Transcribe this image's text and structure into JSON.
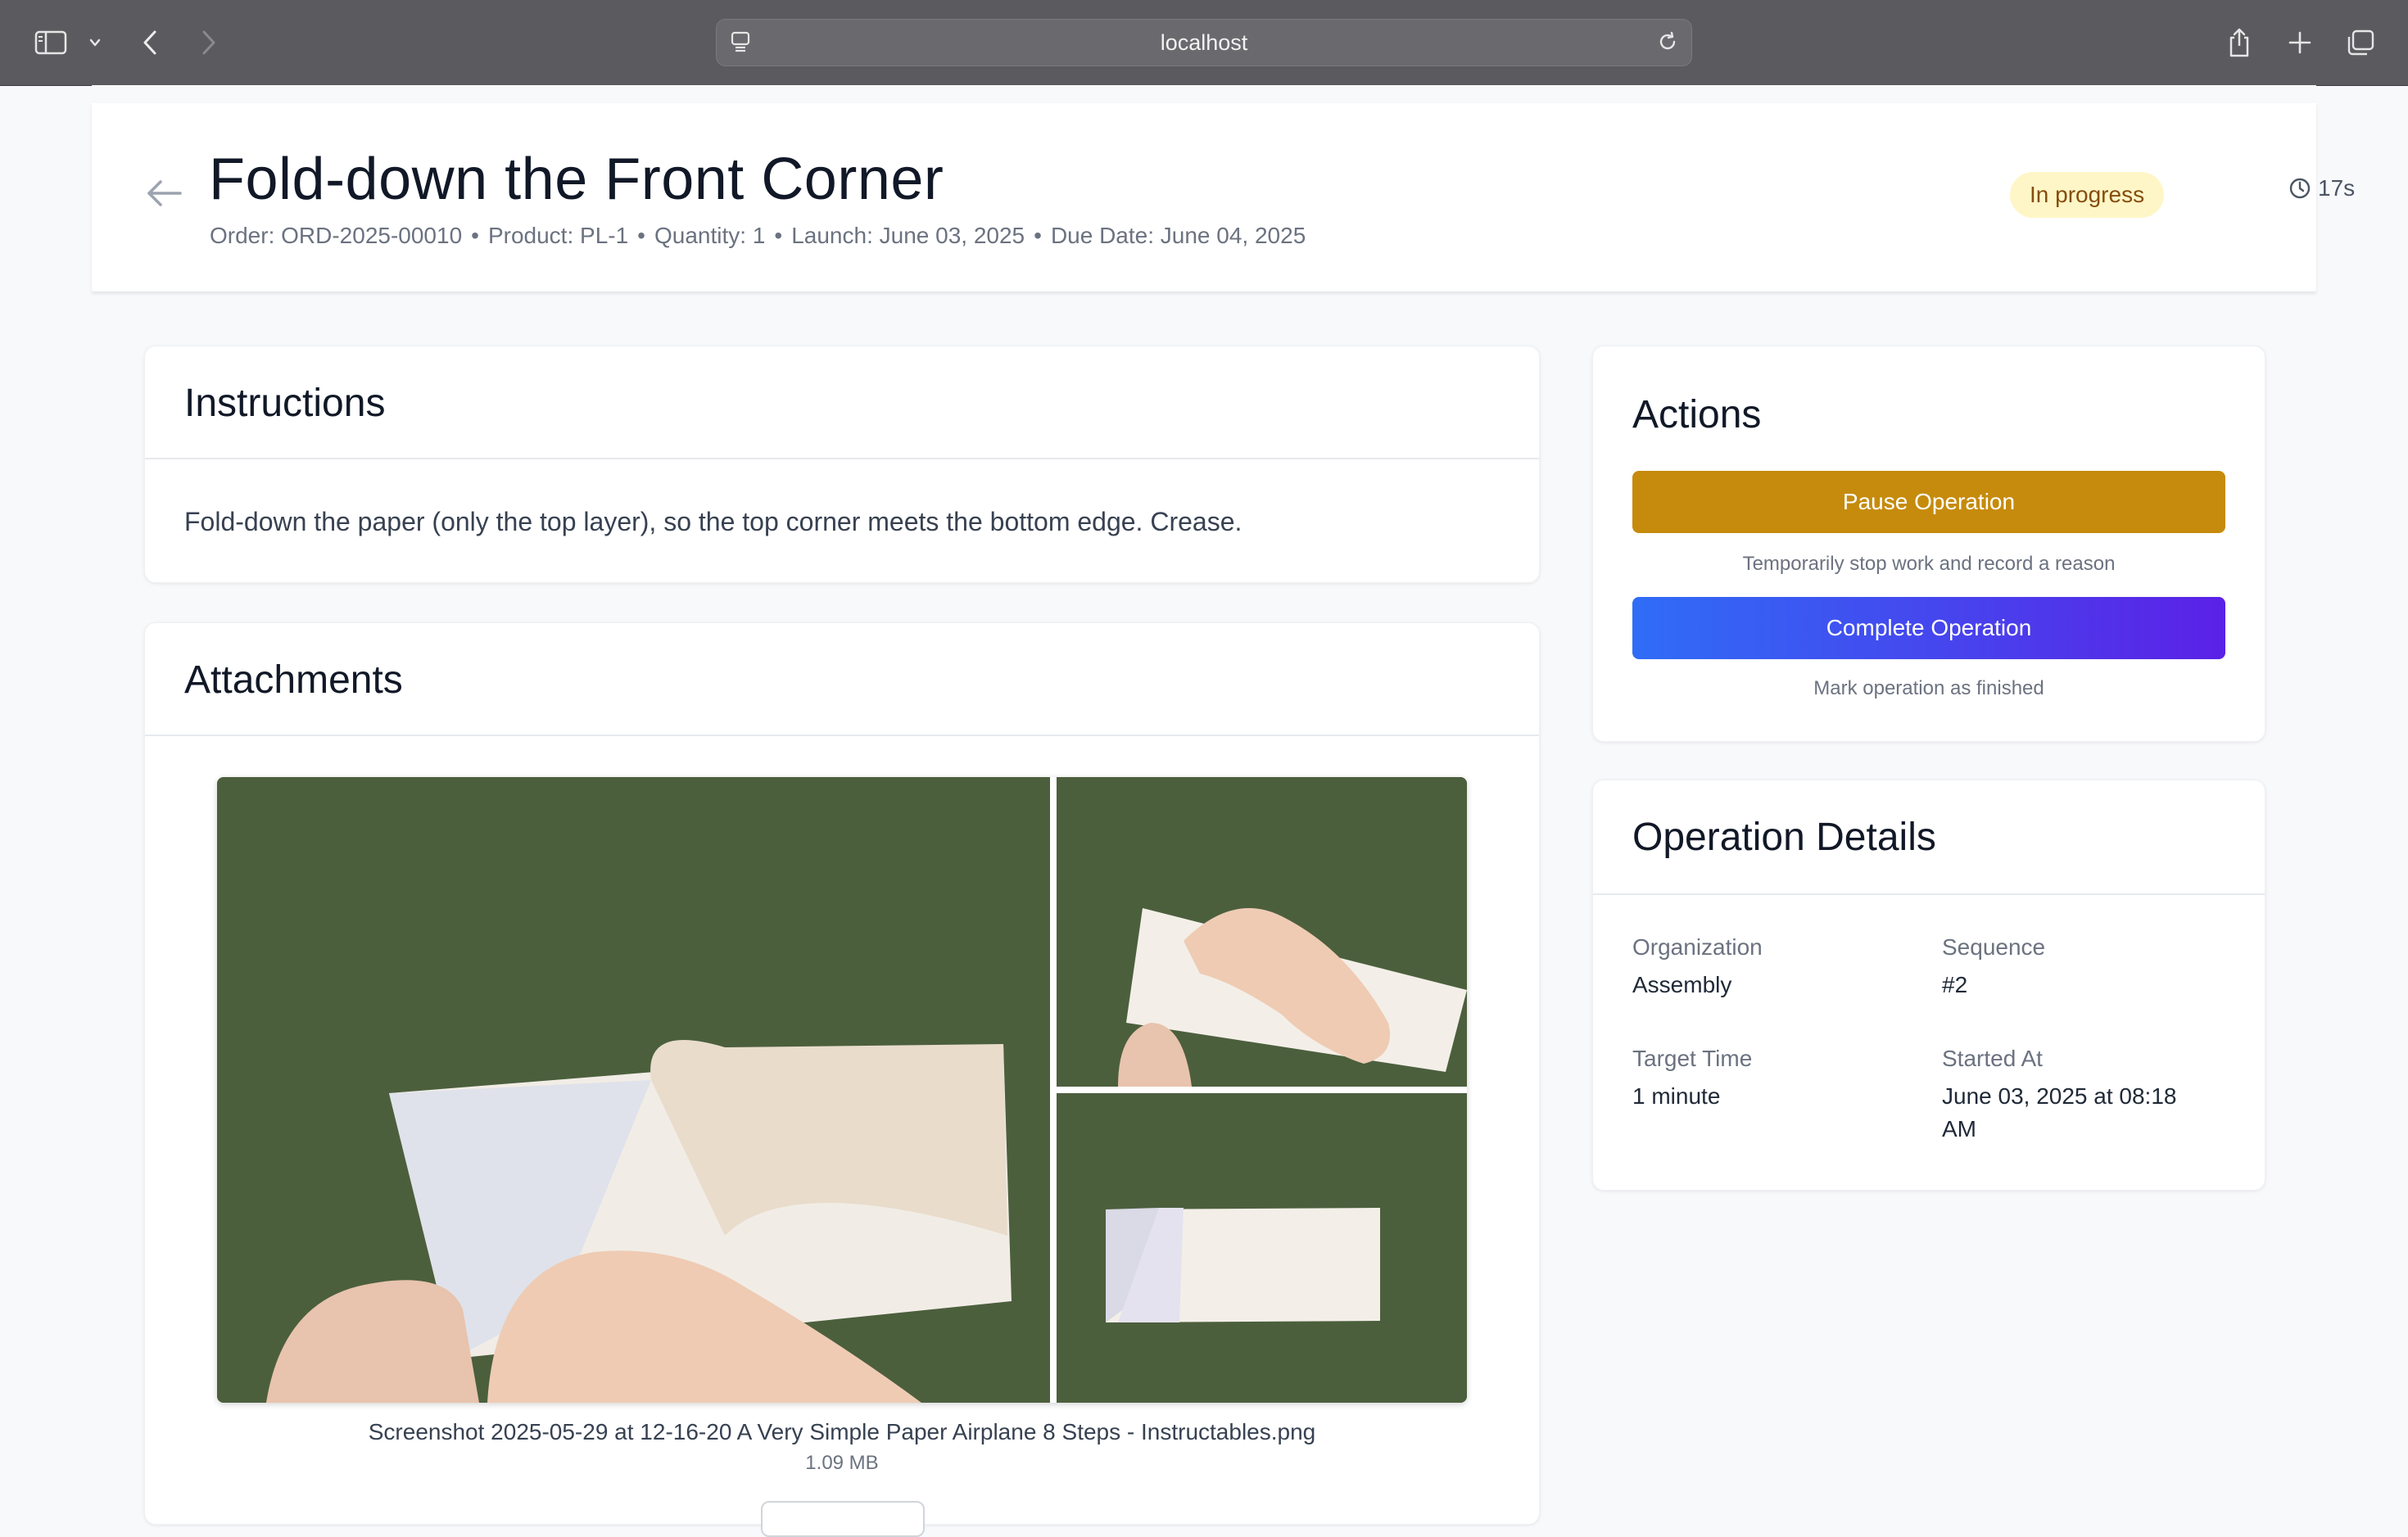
{
  "browser": {
    "url": "localhost",
    "icons": [
      "sidebar-icon",
      "chevron-down-icon",
      "back-icon",
      "forward-icon",
      "page-menu-icon",
      "reload-icon",
      "share-icon",
      "new-tab-icon",
      "tabs-overview-icon"
    ]
  },
  "header": {
    "title": "Fold-down the Front Corner",
    "meta": {
      "order": "Order: ORD-2025-00010",
      "product": "Product: PL-1",
      "quantity": "Quantity: 1",
      "launch": "Launch: June 03, 2025",
      "due": "Due Date: June 04, 2025",
      "separator": "•"
    },
    "status": "In progress",
    "timer": "17s",
    "colors": {
      "status_bg": "#fef6c7",
      "status_text": "#854d0e"
    }
  },
  "instructions": {
    "title": "Instructions",
    "text": "Fold-down the paper (only the top layer), so the top corner meets the bottom edge. Crease."
  },
  "attachments": {
    "title": "Attachments",
    "items": [
      {
        "file_name": "Screenshot 2025-05-29 at 12-16-20 A Very Simple Paper Airplane 8 Steps - Instructables.png",
        "file_size": "1.09 MB"
      }
    ]
  },
  "actions": {
    "title": "Actions",
    "pause": {
      "label": "Pause Operation",
      "hint": "Temporarily stop work and record a reason",
      "color": "#c68b0c"
    },
    "complete": {
      "label": "Complete Operation",
      "hint": "Mark operation as finished",
      "colors": [
        "#2f6df6",
        "#5b21e6"
      ]
    }
  },
  "details": {
    "title": "Operation Details",
    "organization": {
      "label": "Organization",
      "value": "Assembly"
    },
    "sequence": {
      "label": "Sequence",
      "value": "#2"
    },
    "target_time": {
      "label": "Target Time",
      "value": "1 minute"
    },
    "started_at": {
      "label": "Started At",
      "value_line1": "June 03, 2025 at 08:18",
      "value_line2": "AM"
    }
  }
}
